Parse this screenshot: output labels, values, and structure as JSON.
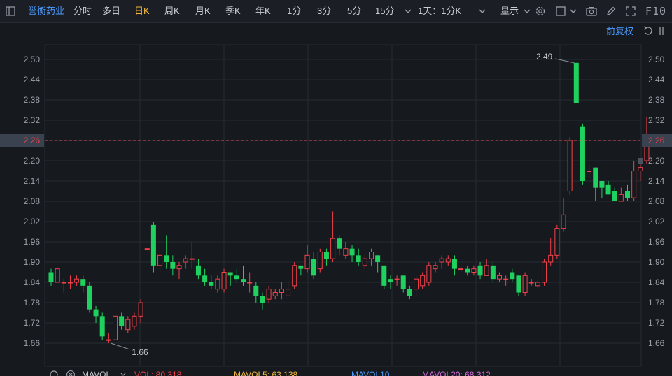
{
  "toolbar": {
    "stock_name": "誉衡药业",
    "periods": [
      "分时",
      "多日",
      "日K",
      "周K",
      "月K",
      "季K",
      "年K",
      "1分",
      "3分",
      "5分",
      "15分"
    ],
    "active_period": "日K",
    "intraday_select": "1天：1分K",
    "display_label": "显示",
    "f10_label": "F10",
    "icons": [
      "panel-toggle-icon",
      "chevron-down-icon",
      "gear-icon",
      "square-icon",
      "camera-icon",
      "pencil-icon",
      "fullscreen-icon"
    ]
  },
  "adjust_label": "前复权",
  "colors": {
    "up": "#f2414a",
    "down": "#1fd15f",
    "bg": "#161a1f",
    "grid": "#262b33",
    "price_line": "#e05050",
    "accent": "#4c9bff"
  },
  "chart_data": {
    "type": "candlestick",
    "ylim": [
      1.62,
      2.54
    ],
    "y_ticks": [
      "2.50",
      "2.44",
      "2.38",
      "2.32",
      "2.26",
      "2.20",
      "2.14",
      "2.08",
      "2.02",
      "1.96",
      "1.90",
      "1.84",
      "1.78",
      "1.72",
      "1.66"
    ],
    "current_price": "2.26",
    "max_label": "2.49",
    "min_label": "1.66",
    "candles": [
      [
        1.87,
        1.84,
        1.88,
        1.83
      ],
      [
        1.84,
        1.88,
        1.88,
        1.84
      ],
      [
        1.84,
        1.84,
        1.85,
        1.81
      ],
      [
        1.84,
        1.84,
        1.86,
        1.82
      ],
      [
        1.84,
        1.85,
        1.86,
        1.83
      ],
      [
        1.85,
        1.83,
        1.86,
        1.81
      ],
      [
        1.83,
        1.76,
        1.84,
        1.75
      ],
      [
        1.76,
        1.74,
        1.77,
        1.72
      ],
      [
        1.74,
        1.68,
        1.75,
        1.67
      ],
      [
        1.67,
        1.67,
        1.69,
        1.66
      ],
      [
        1.67,
        1.74,
        1.75,
        1.67
      ],
      [
        1.74,
        1.71,
        1.75,
        1.7
      ],
      [
        1.7,
        1.73,
        1.74,
        1.69
      ],
      [
        1.71,
        1.74,
        1.75,
        1.7
      ],
      [
        1.74,
        1.78,
        1.79,
        1.72
      ],
      [
        1.94,
        1.94,
        1.94,
        1.94
      ],
      [
        2.01,
        1.89,
        2.02,
        1.87
      ],
      [
        1.89,
        1.92,
        1.92,
        1.87
      ],
      [
        1.92,
        1.9,
        1.98,
        1.88
      ],
      [
        1.9,
        1.88,
        1.92,
        1.86
      ],
      [
        1.88,
        1.89,
        1.9,
        1.85
      ],
      [
        1.9,
        1.91,
        1.92,
        1.88
      ],
      [
        1.91,
        1.91,
        1.96,
        1.88
      ],
      [
        1.89,
        1.86,
        1.91,
        1.85
      ],
      [
        1.86,
        1.84,
        1.88,
        1.83
      ],
      [
        1.84,
        1.83,
        1.86,
        1.82
      ],
      [
        1.82,
        1.85,
        1.86,
        1.81
      ],
      [
        1.82,
        1.87,
        1.88,
        1.81
      ],
      [
        1.87,
        1.86,
        1.87,
        1.83
      ],
      [
        1.86,
        1.85,
        1.88,
        1.84
      ],
      [
        1.85,
        1.84,
        1.89,
        1.83
      ],
      [
        1.84,
        1.84,
        1.87,
        1.81
      ],
      [
        1.83,
        1.8,
        1.84,
        1.78
      ],
      [
        1.8,
        1.78,
        1.81,
        1.76
      ],
      [
        1.79,
        1.82,
        1.83,
        1.78
      ],
      [
        1.8,
        1.81,
        1.82,
        1.79
      ],
      [
        1.81,
        1.82,
        1.84,
        1.79
      ],
      [
        1.8,
        1.82,
        1.84,
        1.8
      ],
      [
        1.83,
        1.89,
        1.9,
        1.82
      ],
      [
        1.89,
        1.88,
        1.89,
        1.86
      ],
      [
        1.88,
        1.92,
        1.95,
        1.87
      ],
      [
        1.91,
        1.86,
        1.93,
        1.85
      ],
      [
        1.88,
        1.93,
        1.94,
        1.87
      ],
      [
        1.93,
        1.91,
        1.94,
        1.89
      ],
      [
        1.91,
        1.97,
        2.05,
        1.9
      ],
      [
        1.97,
        1.94,
        1.98,
        1.92
      ],
      [
        1.92,
        1.94,
        1.96,
        1.91
      ],
      [
        1.94,
        1.92,
        1.95,
        1.9
      ],
      [
        1.92,
        1.9,
        1.94,
        1.89
      ],
      [
        1.89,
        1.91,
        1.92,
        1.88
      ],
      [
        1.91,
        1.93,
        1.94,
        1.89
      ],
      [
        1.92,
        1.9,
        1.92,
        1.87
      ],
      [
        1.89,
        1.83,
        1.89,
        1.82
      ],
      [
        1.85,
        1.84,
        1.86,
        1.82
      ],
      [
        1.85,
        1.85,
        1.86,
        1.83
      ],
      [
        1.86,
        1.82,
        1.86,
        1.81
      ],
      [
        1.82,
        1.8,
        1.83,
        1.79
      ],
      [
        1.82,
        1.85,
        1.86,
        1.8
      ],
      [
        1.83,
        1.86,
        1.87,
        1.82
      ],
      [
        1.84,
        1.89,
        1.9,
        1.83
      ],
      [
        1.88,
        1.89,
        1.9,
        1.87
      ],
      [
        1.9,
        1.91,
        1.92,
        1.88
      ],
      [
        1.9,
        1.91,
        1.92,
        1.89
      ],
      [
        1.91,
        1.88,
        1.92,
        1.86
      ],
      [
        1.88,
        1.88,
        1.89,
        1.87
      ],
      [
        1.88,
        1.87,
        1.89,
        1.86
      ],
      [
        1.87,
        1.88,
        1.89,
        1.86
      ],
      [
        1.89,
        1.86,
        1.9,
        1.85
      ],
      [
        1.86,
        1.89,
        1.91,
        1.86
      ],
      [
        1.89,
        1.85,
        1.9,
        1.84
      ],
      [
        1.85,
        1.86,
        1.87,
        1.84
      ],
      [
        1.85,
        1.85,
        1.86,
        1.83
      ],
      [
        1.87,
        1.85,
        1.88,
        1.84
      ],
      [
        1.86,
        1.81,
        1.86,
        1.8
      ],
      [
        1.81,
        1.86,
        1.87,
        1.8
      ],
      [
        1.84,
        1.84,
        1.85,
        1.83
      ],
      [
        1.83,
        1.84,
        1.85,
        1.82
      ],
      [
        1.84,
        1.9,
        1.91,
        1.83
      ],
      [
        1.9,
        1.92,
        1.97,
        1.89
      ],
      [
        1.92,
        2.0,
        2.01,
        1.91
      ],
      [
        2.0,
        2.04,
        2.09,
        1.99
      ],
      [
        2.11,
        2.26,
        2.27,
        2.1
      ],
      [
        2.49,
        2.37,
        2.49,
        2.37
      ],
      [
        2.3,
        2.14,
        2.31,
        2.13
      ],
      [
        2.17,
        2.17,
        2.19,
        2.15
      ],
      [
        2.18,
        2.12,
        2.18,
        2.08
      ],
      [
        2.14,
        2.12,
        2.14,
        2.09
      ],
      [
        2.13,
        2.1,
        2.14,
        2.1
      ],
      [
        2.11,
        2.08,
        2.12,
        2.08
      ],
      [
        2.08,
        2.1,
        2.12,
        2.08
      ],
      [
        2.11,
        2.09,
        2.13,
        2.08
      ],
      [
        2.09,
        2.17,
        2.2,
        2.08
      ],
      [
        2.17,
        2.18,
        2.19,
        2.14
      ],
      [
        2.2,
        2.26,
        2.33,
        2.19
      ]
    ]
  },
  "indicators": {
    "mavol_label": "MAVOL",
    "vol": "VOL: 80.318",
    "mavol5": "MAVOL5: 63.138",
    "mavol10": "MAVOL10",
    "mavol20": "MAVOL20: 68.312"
  }
}
